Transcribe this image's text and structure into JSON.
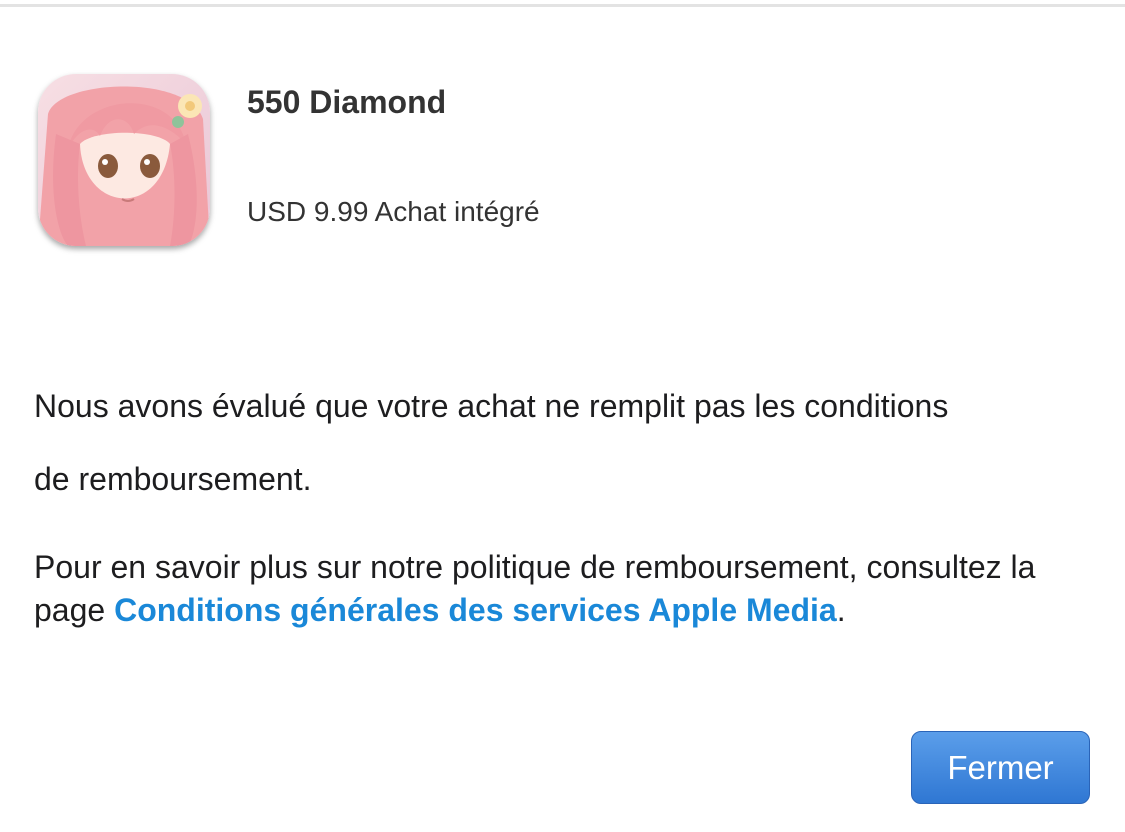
{
  "product": {
    "name": "550 Diamond",
    "price_line": "USD 9.99 Achat intégré",
    "icon": "app-icon-anime-girl"
  },
  "message": {
    "line1": "Nous avons évalué que votre achat ne remplit pas les conditions",
    "line2": "de remboursement."
  },
  "policy": {
    "text_before": "Pour en savoir plus sur notre politique de remboursement, consultez la page ",
    "link_text": "Conditions générales des services Apple Media",
    "text_after": "."
  },
  "actions": {
    "close_label": "Fermer"
  },
  "colors": {
    "link": "#1a88d8",
    "button": "#3a82dd",
    "divider": "#e3e3e3"
  }
}
